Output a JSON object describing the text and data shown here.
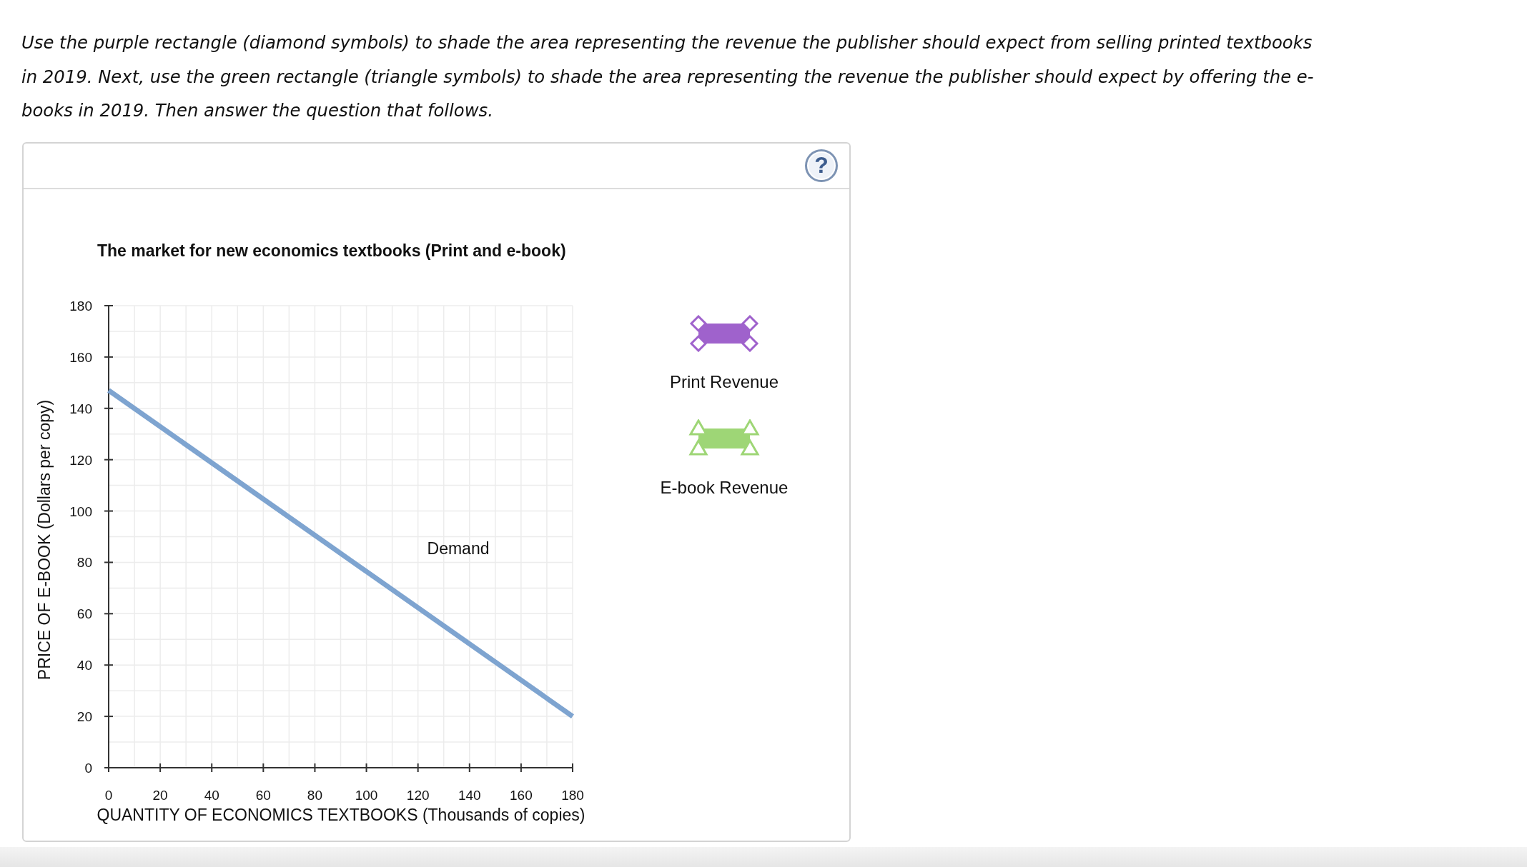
{
  "instructions": "Use the purple rectangle (diamond symbols) to shade the area representing the revenue the publisher should expect from selling printed textbooks in 2019. Next, use the green rectangle (triangle symbols) to shade the area representing the revenue the publisher should expect by offering the e-books in 2019. Then answer the question that follows.",
  "help_button": {
    "label": "?"
  },
  "chart": {
    "chart_data": {
      "type": "line",
      "grid": true,
      "title": "The market for new economics textbooks (Print and e-book)",
      "xlabel": "QUANTITY OF ECONOMICS TEXTBOOKS (Thousands of copies)",
      "ylabel": "PRICE OF E-BOOK (Dollars per copy)",
      "x": [
        0,
        180
      ],
      "series": [
        {
          "name": "Demand",
          "color": "#7ea4d0",
          "values": [
            147,
            20
          ]
        }
      ],
      "xlim": [
        0,
        180
      ],
      "ylim": [
        0,
        180
      ],
      "xticks": [
        0,
        20,
        40,
        60,
        80,
        100,
        120,
        140,
        160,
        180
      ],
      "yticks": [
        0,
        20,
        40,
        60,
        80,
        100,
        120,
        140,
        160,
        180
      ]
    }
  },
  "legend": [
    {
      "kind": "diamond",
      "label": "Print Revenue",
      "color": "#9f62cc"
    },
    {
      "kind": "triangle",
      "label": "E-book Revenue",
      "color": "#9ed676"
    }
  ]
}
